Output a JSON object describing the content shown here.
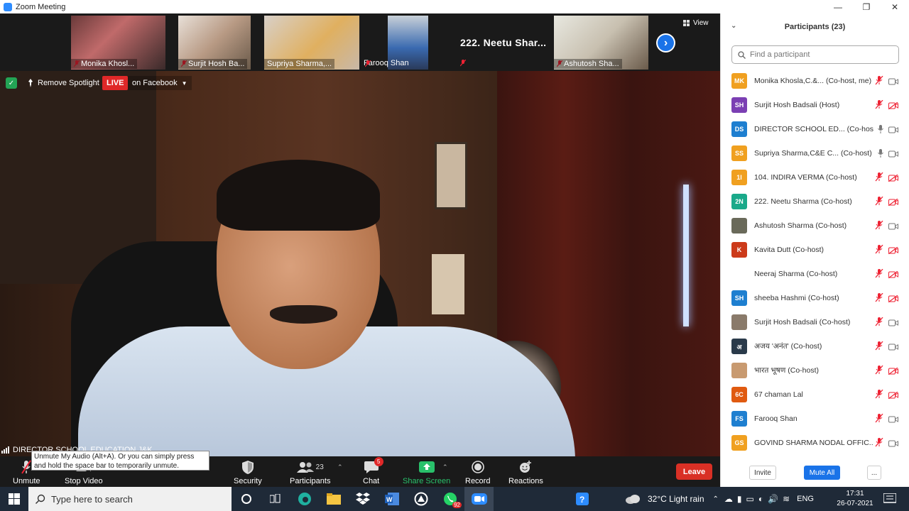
{
  "window": {
    "title": "Zoom Meeting"
  },
  "thumbnails": [
    {
      "name": "Monika Khosl..."
    },
    {
      "name": "Surjit Hosh Ba..."
    },
    {
      "name": "Supriya Sharma,..."
    },
    {
      "name": "Farooq Shan"
    },
    {
      "name": "222. Neetu Shar..."
    },
    {
      "name": "Ashutosh Sha..."
    }
  ],
  "view_label": "View",
  "overlay": {
    "remove_spotlight": "Remove Spotlight",
    "live": "LIVE",
    "on_facebook": "on Facebook",
    "speaker_name": "DIRECTOR SCHOOL EDUCATION J&K"
  },
  "tooltip": "Unmute My Audio (Alt+A). Or you can simply press and hold the space bar to temporarily unmute.",
  "toolbar": {
    "unmute": "Unmute",
    "stop_video": "Stop Video",
    "security": "Security",
    "participants": "Participants",
    "participants_count": "23",
    "chat": "Chat",
    "chat_badge": "5",
    "share_screen": "Share Screen",
    "record": "Record",
    "reactions": "Reactions",
    "leave": "Leave"
  },
  "panel": {
    "title": "Participants (23)",
    "search_placeholder": "Find a participant",
    "invite": "Invite",
    "mute_all": "Mute All",
    "more": "...",
    "participants": [
      {
        "initials": "MK",
        "name": "Monika Khosla,C.&... (Co-host, me)",
        "color": "#f0a020",
        "mic": "muted",
        "video": "on"
      },
      {
        "initials": "SH",
        "name": "Surjit Hosh Badsali (Host)",
        "color": "#7b3fb3",
        "mic": "muted",
        "video": "off"
      },
      {
        "initials": "DS",
        "name": "DIRECTOR SCHOOL ED... (Co-host)",
        "color": "#1e7fd0",
        "mic": "on",
        "video": "on"
      },
      {
        "initials": "SS",
        "name": "Supriya Sharma,C&E C... (Co-host)",
        "color": "#f0a020",
        "mic": "on",
        "video": "on"
      },
      {
        "initials": "1I",
        "name": "104. INDIRA VERMA (Co-host)",
        "color": "#f0a020",
        "mic": "muted",
        "video": "off"
      },
      {
        "initials": "2N",
        "name": "222. Neetu Sharma (Co-host)",
        "color": "#1aa98a",
        "mic": "muted",
        "video": "off"
      },
      {
        "initials": "",
        "name": "Ashutosh Sharma (Co-host)",
        "color": "#6a6a5a",
        "mic": "muted",
        "video": "on"
      },
      {
        "initials": "K",
        "name": "Kavita Dutt (Co-host)",
        "color": "#cc3a1a",
        "mic": "muted",
        "video": "off"
      },
      {
        "initials": "",
        "name": "Neeraj Sharma (Co-host)",
        "color": "#ffffff",
        "mic": "muted",
        "video": "off"
      },
      {
        "initials": "SH",
        "name": "sheeba Hashmi (Co-host)",
        "color": "#1e7fd0",
        "mic": "muted",
        "video": "off"
      },
      {
        "initials": "",
        "name": "Surjit Hosh Badsali (Co-host)",
        "color": "#8a7a6a",
        "mic": "muted",
        "video": "on"
      },
      {
        "initials": "अ",
        "name": "अजय 'अनंत' (Co-host)",
        "color": "#2a3a4a",
        "mic": "muted",
        "video": "on"
      },
      {
        "initials": "",
        "name": "भारत भूषण (Co-host)",
        "color": "#c89a70",
        "mic": "muted",
        "video": "off"
      },
      {
        "initials": "6C",
        "name": "67 chaman Lal",
        "color": "#e05a10",
        "mic": "muted",
        "video": "off"
      },
      {
        "initials": "FS",
        "name": "Farooq Shan",
        "color": "#1e7fd0",
        "mic": "muted",
        "video": "on"
      },
      {
        "initials": "GS",
        "name": "GOVIND SHARMA NODAL OFFIC...",
        "color": "#f0a020",
        "mic": "muted",
        "video": "on"
      }
    ]
  },
  "taskbar": {
    "search_placeholder": "Type here to search",
    "whatsapp_badge": "92",
    "weather": "32°C  Light rain",
    "lang": "ENG",
    "time": "17:31",
    "date": "26-07-2021"
  }
}
